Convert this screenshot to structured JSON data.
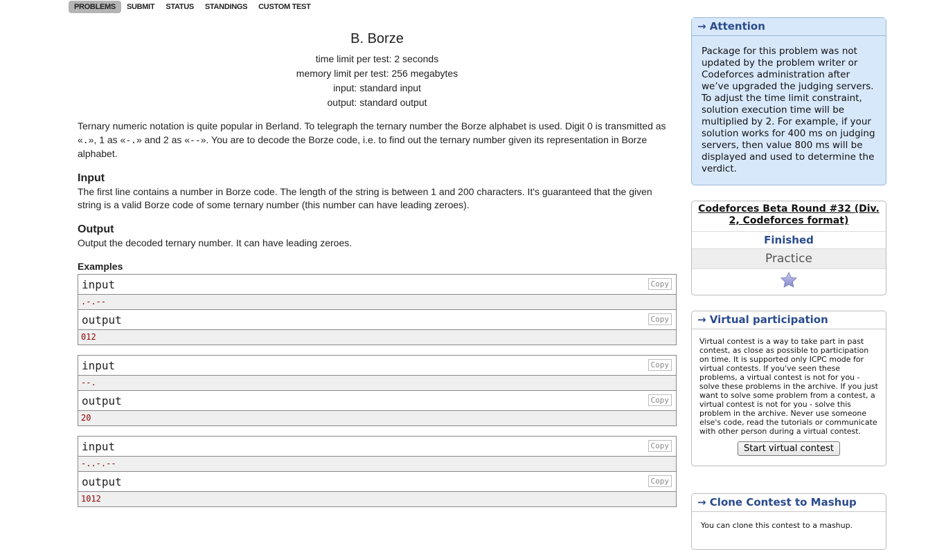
{
  "nav": {
    "tabs": [
      "PROBLEMS",
      "SUBMIT",
      "STATUS",
      "STANDINGS",
      "CUSTOM TEST"
    ],
    "active": "PROBLEMS"
  },
  "problem": {
    "title": "B. Borze",
    "time_limit": "time limit per test: 2 seconds",
    "memory_limit": "memory limit per test: 256 megabytes",
    "input_file": "input: standard input",
    "output_file": "output: standard output",
    "legend": {
      "p1": "Ternary numeric notation is quite popular in Berland. To telegraph the ternary number the Borze alphabet is used. Digit 0 is transmitted as «",
      "c0": ".",
      "p2": "», 1 as «",
      "c1": "-.",
      "p3": "» and 2 as «",
      "c2": "--",
      "p4": "». You are to decode the Borze code, i.e. to find out the ternary number given its representation in Borze alphabet."
    },
    "input_title": "Input",
    "input_text": "The first line contains a number in Borze code. The length of the string is between 1 and 200 characters. It's guaranteed that the given string is a valid Borze code of some ternary number (this number can have leading zeroes).",
    "output_title": "Output",
    "output_text": "Output the decoded ternary number. It can have leading zeroes.",
    "examples_title": "Examples",
    "input_label": "input",
    "output_label": "output",
    "copy_label": "Copy",
    "examples": [
      {
        "input": ".-.--",
        "output": "012"
      },
      {
        "input": "--.",
        "output": "20"
      },
      {
        "input": "-..-.--",
        "output": "1012"
      }
    ]
  },
  "sidebar": {
    "attention": {
      "caption": "→ Attention",
      "text": "Package for this problem was not updated by the problem writer or Codeforces administration after we’ve upgraded the judging servers. To adjust the time limit constraint, solution execution time will be multiplied by 2. For example, if your solution works for 400 ms on judging servers, then value 800 ms will be displayed and used to determine the verdict."
    },
    "contest": {
      "name": "Codeforces Beta Round #32 (Div. 2, Codeforces format)",
      "phase": "Finished",
      "mode": "Practice",
      "star_icon": "star-icon"
    },
    "virtual": {
      "caption": "→ Virtual participation",
      "text": "Virtual contest is a way to take part in past contest, as close as possible to participation on time. It is supported only ICPC mode for virtual contests. If you've seen these problems, a virtual contest is not for you - solve these problems in the archive. If you just want to solve some problem from a contest, a virtual contest is not for you - solve this problem in the archive. Never use someone else's code, read the tutorials or communicate with other person during a virtual contest.",
      "button": "Start virtual contest"
    },
    "clone": {
      "caption": "→ Clone Contest to Mashup",
      "text": "You can clone this contest to a mashup."
    }
  },
  "colors": {
    "accent": "#2a4b8d",
    "attention_bg": "#d8e8fb",
    "test_data": "#8b0000"
  }
}
